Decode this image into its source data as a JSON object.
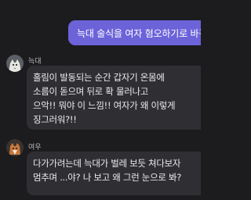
{
  "chat": {
    "outgoing": {
      "text": "늑대 술식을 여자 혐오하기로 바꾸면"
    },
    "messages": [
      {
        "sender": "늑대",
        "avatar_icon": "wolf-avatar-icon",
        "lines": [
          "홀림이 발동되는 순간 갑자기 온몸에",
          "소름이 돋으며 뒤로 확 물러나고",
          "으악!! 뭐야 이 느낌!! 여자가 왜 이렇게",
          "징그러워?!!"
        ]
      },
      {
        "sender": "여우",
        "avatar_icon": "fox-avatar-icon",
        "lines": [
          "다가가려는데 늑대가 벌레 보듯 쳐다보자",
          "멈추며 ...야? 나 보고 왜 그런 눈으로 봐?"
        ]
      }
    ]
  }
}
